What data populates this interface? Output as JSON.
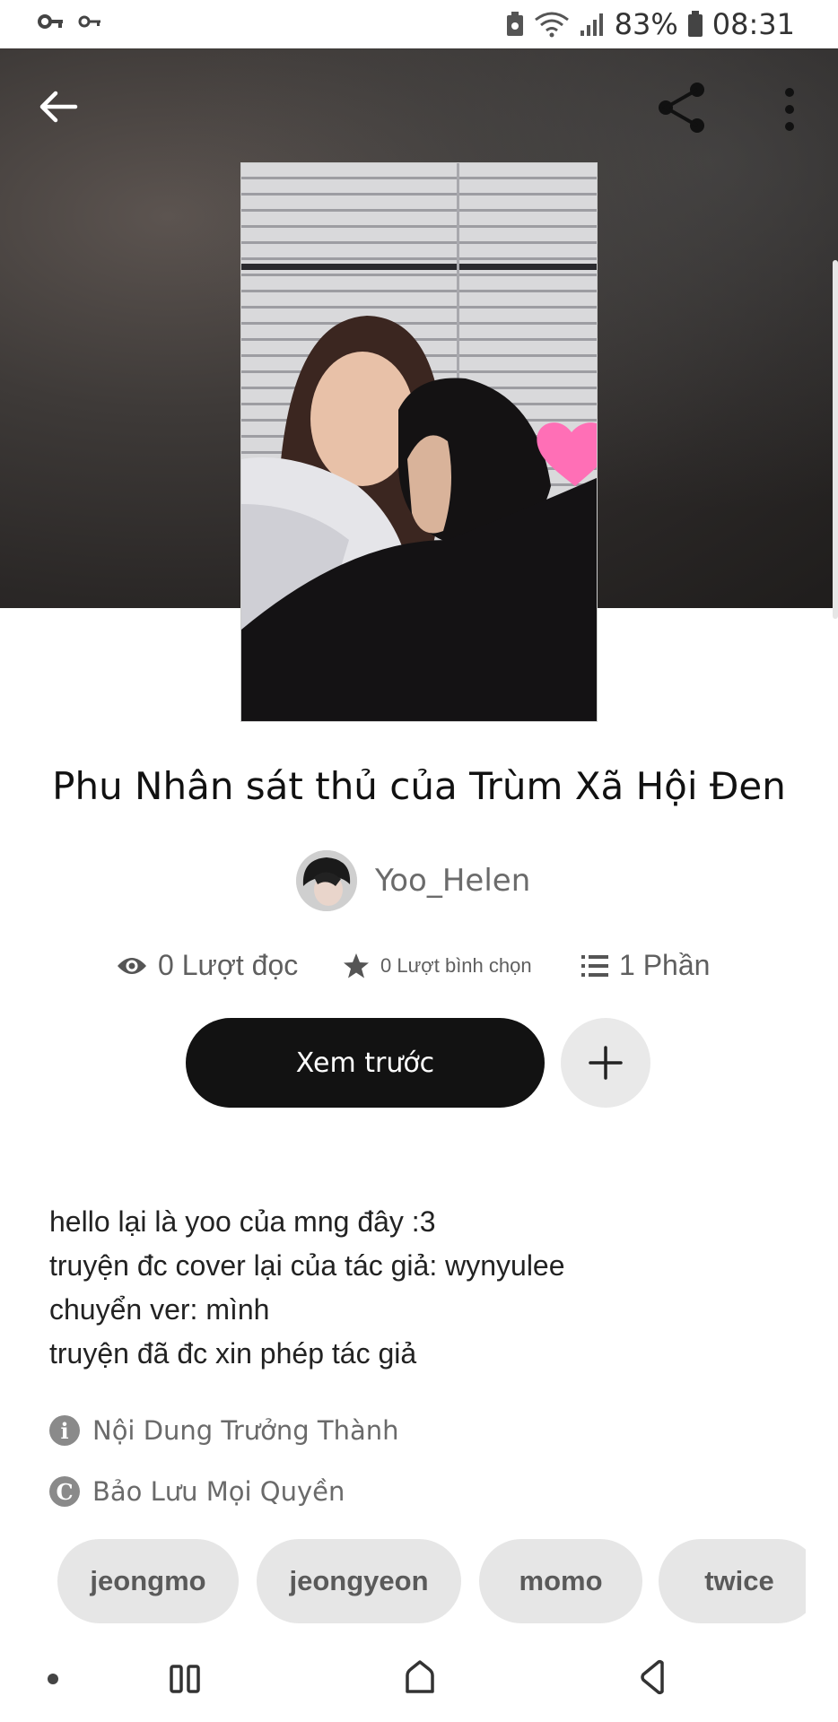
{
  "status_bar": {
    "battery_percent": "83%",
    "time": "08:31"
  },
  "story": {
    "title": "Phu Nhân sát thủ của Trùm Xã Hội Đen",
    "author": "Yoo_Helen",
    "stats": {
      "reads": "0 Lượt đọc",
      "votes": "0 Lượt bình chọn",
      "parts": "1 Phần"
    },
    "preview_label": "Xem trước",
    "description": [
      "hello lại là yoo của mng đây :3",
      "truyện đc cover lại của tác giả: wynyulee",
      "chuyển ver: mình",
      "truyện đã đc xin phép tác giả"
    ],
    "mature_label": "Nội Dung Trưởng Thành",
    "rights_label": "Bảo Lưu Mọi Quyền",
    "tags": [
      "jeongmo",
      "jeongyeon",
      "momo",
      "twice"
    ]
  },
  "icons": {
    "back": "arrow-left-icon",
    "share": "share-icon",
    "more": "more-vertical-icon",
    "reads": "eye-icon",
    "votes": "star-icon",
    "parts": "list-icon",
    "add": "plus-icon",
    "mature": "info-icon",
    "rights": "copyright-icon"
  },
  "colors": {
    "preview_button": "#121212",
    "add_button": "#e9e9e9",
    "tag_background": "#e6e6e6",
    "accent_heart": "#ff6fb6"
  }
}
